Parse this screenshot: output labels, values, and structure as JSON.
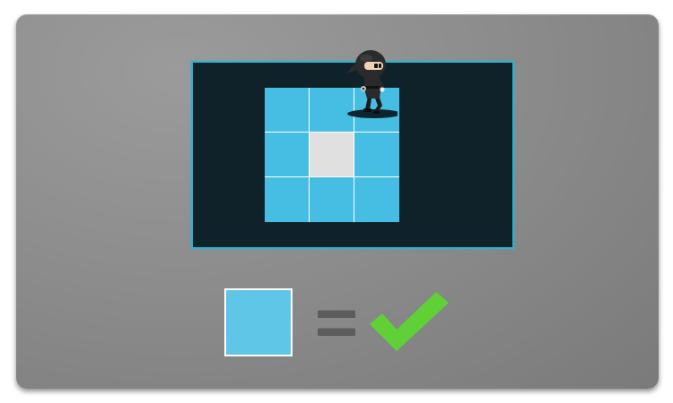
{
  "game": {
    "colors": {
      "background_card": "#8f8f8f",
      "stage": "#0f2229",
      "stage_border": "#2bb3cf",
      "tile_blue": "#46bde3",
      "tile_white": "#e0e0e0",
      "target_swatch": "#60c6e8",
      "check_green": "#5fd137",
      "equals_bar": "#5c5c5c"
    },
    "grid": {
      "rows": 3,
      "cols": 3,
      "tiles": [
        [
          "blue",
          "blue",
          "blue"
        ],
        [
          "blue",
          "white",
          "blue"
        ],
        [
          "blue",
          "blue",
          "blue"
        ]
      ]
    },
    "character": {
      "name_icon": "ninja-icon",
      "on_tile": [
        0,
        2
      ]
    },
    "rule": {
      "target_color": "blue",
      "symbol": "equals-icon",
      "result": "check-icon"
    }
  }
}
